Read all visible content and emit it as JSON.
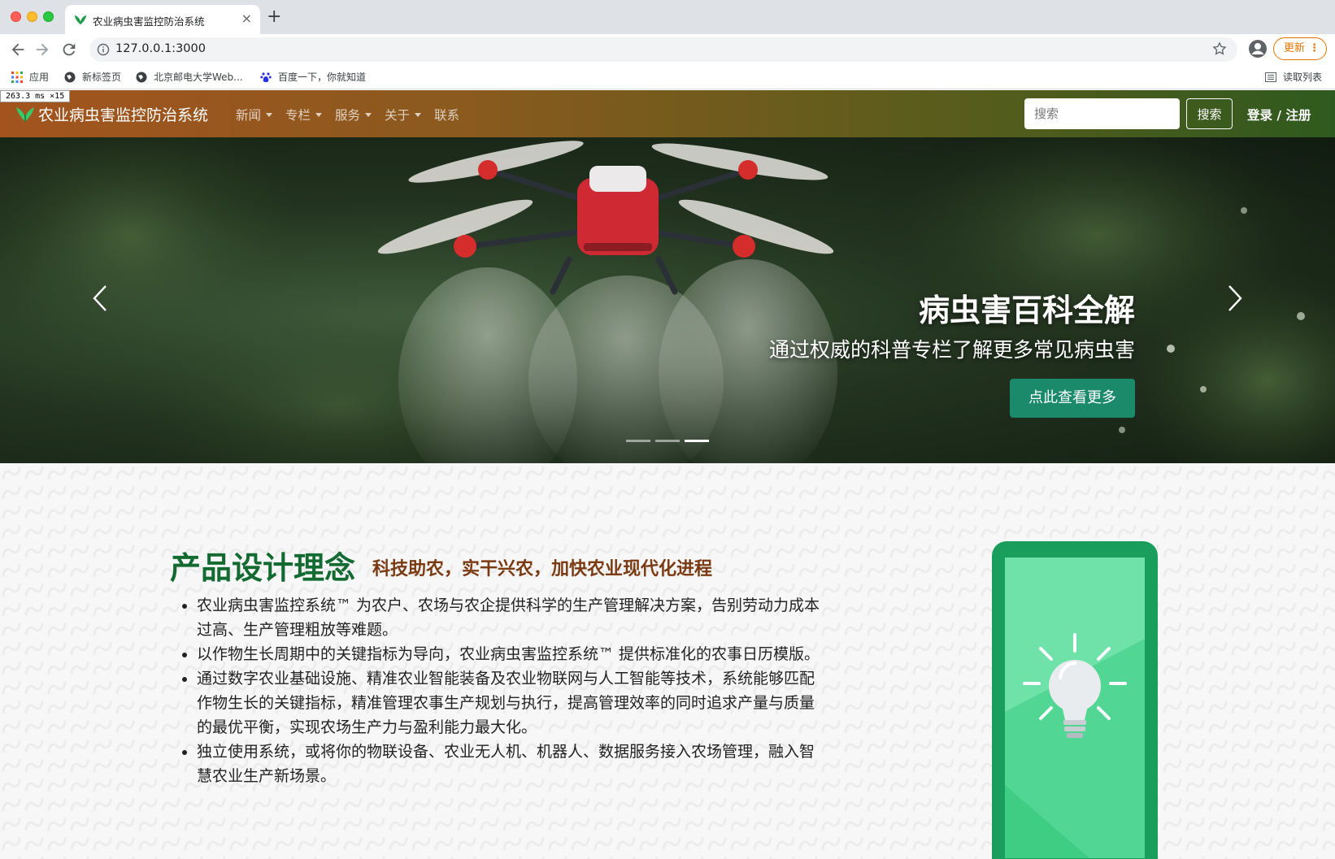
{
  "browser": {
    "tab_title": "农业病虫害监控防治系统",
    "tab_close": "×",
    "new_tab": "+",
    "url": "127.0.0.1:3000",
    "update_label": "更新",
    "update_menu": "⋮",
    "bookmarks": [
      "应用",
      "新标签页",
      "北京邮电大学Web...",
      "百度一下，你就知道"
    ],
    "reading_list": "读取列表",
    "timing": "263.3 ms ×15"
  },
  "navbar": {
    "brand": "农业病虫害监控防治系统",
    "menu": [
      {
        "label": "新闻",
        "dropdown": true
      },
      {
        "label": "专栏",
        "dropdown": true
      },
      {
        "label": "服务",
        "dropdown": true
      },
      {
        "label": "关于",
        "dropdown": true
      },
      {
        "label": "联系",
        "dropdown": false
      }
    ],
    "search_placeholder": "搜索",
    "search_button": "搜索",
    "auth": "登录 / 注册",
    "gradient": [
      "#a3541e",
      "#2f5a1f"
    ]
  },
  "hero": {
    "title": "病虫害百科全解",
    "subtitle": "通过权威的科普专栏了解更多常见病虫害",
    "button": "点此查看更多",
    "button_color": "#1a8a6a",
    "slides": 3,
    "active_slide": 3
  },
  "section": {
    "title": "产品设计理念",
    "subtitle": "科技助农，实干兴农，加快农业现代化进程",
    "title_color": "#136b32",
    "subtitle_color": "#7a3a12",
    "points": [
      "农业病虫害监控系统™ 为农户、农场与农企提供科学的生产管理解决方案，告别劳动力成本过高、生产管理粗放等难题。",
      "以作物生长周期中的关键指标为导向，农业病虫害监控系统™ 提供标准化的农事日历模版。",
      "通过数字农业基础设施、精准农业智能装备及农业物联网与人工智能等技术，系统能够匹配作物生长的关键指标，精准管理农事生产规划与执行，提高管理效率的同时追求产量与质量的最优平衡，实现农场生产力与盈利能力最大化。",
      "独立使用系统，或将你的物联设备、农业无人机、机器人、数据服务接入农场管理，融入智慧农业生产新场景。"
    ]
  }
}
